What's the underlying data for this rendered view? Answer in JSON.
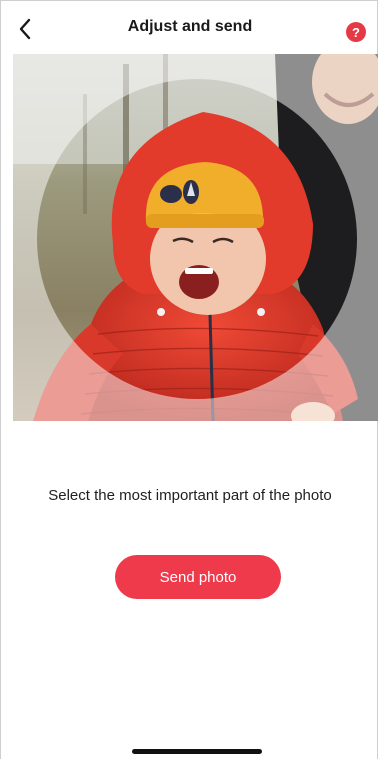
{
  "header": {
    "title": "Adjust and send",
    "back_icon": "chevron-left-icon",
    "help_icon": "help-icon",
    "help_glyph": "?"
  },
  "photo": {
    "crop_shape": "circle"
  },
  "main": {
    "instruction": "Select the most important part of the photo",
    "send_label": "Send photo"
  },
  "colors": {
    "accent": "#ef3a4c",
    "help_badge": "#e63946"
  }
}
